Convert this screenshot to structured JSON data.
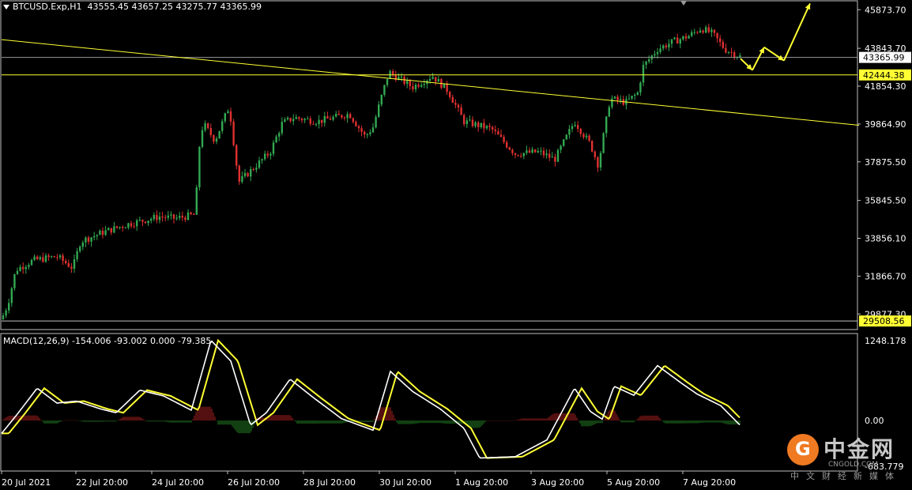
{
  "header": {
    "symbol": "BTCUSD.Exp,H1",
    "ohlc": "43555.45 43657.25 43275.77 43365.99"
  },
  "macd_header": "MACD(12,26,9) -154.006 -93.002 0.000 -79.385",
  "price_axis": [
    "45873.70",
    "43843.70",
    "41854.30",
    "39864.90",
    "37875.50",
    "35845.50",
    "33856.10",
    "31866.70",
    "29877.30"
  ],
  "macd_axis": [
    "1248.178",
    "0.00",
    "-683.779"
  ],
  "price_tags": {
    "current": "43365.99",
    "level_high": "42444.38",
    "level_low": "29508.56"
  },
  "time_axis": [
    "20 Jul 2021",
    "22 Jul 20:00",
    "24 Jul 20:00",
    "26 Jul 20:00",
    "28 Jul 20:00",
    "30 Jul 20:00",
    "1 Aug 20:00",
    "3 Aug 20:00",
    "5 Aug 20:00",
    "7 Aug 20:00"
  ],
  "watermark": {
    "cn": "中金网",
    "en": "CNGOLD.COM",
    "sub": "中文财经新媒体",
    "logo_glyph": "G"
  },
  "colors": {
    "bull": "#ffffff",
    "bull_body": "#32a852",
    "bear": "#e03030",
    "level": "#ffff33",
    "macd_line": "#ffffff",
    "signal_line": "#ffff33",
    "hist_pos": "#8b1a1a",
    "hist_neg": "#1f6b1f",
    "grid": "#c0c0c0"
  },
  "chart_data": {
    "type": "candlestick",
    "ylim": [
      29100,
      46300
    ],
    "macd_ylim": [
      -683.779,
      1248.178
    ],
    "anchors": [
      {
        "t": 0,
        "p": 29600
      },
      {
        "t": 8,
        "p": 30400
      },
      {
        "t": 18,
        "p": 32200
      },
      {
        "t": 40,
        "p": 32700
      },
      {
        "t": 70,
        "p": 32900
      },
      {
        "t": 90,
        "p": 32300
      },
      {
        "t": 100,
        "p": 33700
      },
      {
        "t": 130,
        "p": 34200
      },
      {
        "t": 160,
        "p": 34600
      },
      {
        "t": 180,
        "p": 34800
      },
      {
        "t": 200,
        "p": 35000
      },
      {
        "t": 220,
        "p": 34900
      },
      {
        "t": 245,
        "p": 35100
      },
      {
        "t": 250,
        "p": 38600
      },
      {
        "t": 255,
        "p": 39900
      },
      {
        "t": 270,
        "p": 39000
      },
      {
        "t": 288,
        "p": 40800
      },
      {
        "t": 300,
        "p": 36800
      },
      {
        "t": 320,
        "p": 37600
      },
      {
        "t": 340,
        "p": 38400
      },
      {
        "t": 355,
        "p": 39900
      },
      {
        "t": 370,
        "p": 40200
      },
      {
        "t": 400,
        "p": 40000
      },
      {
        "t": 440,
        "p": 40400
      },
      {
        "t": 460,
        "p": 39200
      },
      {
        "t": 470,
        "p": 39700
      },
      {
        "t": 480,
        "p": 41200
      },
      {
        "t": 490,
        "p": 42600
      },
      {
        "t": 520,
        "p": 41800
      },
      {
        "t": 545,
        "p": 42400
      },
      {
        "t": 565,
        "p": 41600
      },
      {
        "t": 585,
        "p": 40000
      },
      {
        "t": 620,
        "p": 39600
      },
      {
        "t": 650,
        "p": 38300
      },
      {
        "t": 680,
        "p": 38400
      },
      {
        "t": 700,
        "p": 38000
      },
      {
        "t": 725,
        "p": 40000
      },
      {
        "t": 745,
        "p": 38800
      },
      {
        "t": 755,
        "p": 37700
      },
      {
        "t": 770,
        "p": 41200
      },
      {
        "t": 790,
        "p": 41000
      },
      {
        "t": 805,
        "p": 41500
      },
      {
        "t": 812,
        "p": 42900
      },
      {
        "t": 830,
        "p": 43800
      },
      {
        "t": 850,
        "p": 44200
      },
      {
        "t": 870,
        "p": 44500
      },
      {
        "t": 885,
        "p": 44900
      },
      {
        "t": 900,
        "p": 44600
      },
      {
        "t": 915,
        "p": 43800
      },
      {
        "t": 935,
        "p": 43400
      }
    ],
    "levels": [
      43365.99,
      42444.38,
      29508.56
    ],
    "trendline": [
      [
        0,
        44300
      ],
      [
        1085,
        39800
      ]
    ],
    "projection": [
      [
        935,
        43300
      ],
      [
        950,
        42700
      ],
      [
        965,
        43900
      ],
      [
        990,
        43200
      ],
      [
        1023,
        46200
      ]
    ],
    "macd_anchors": [
      {
        "t": 0,
        "m": -200
      },
      {
        "t": 20,
        "m": 100
      },
      {
        "t": 45,
        "m": 500
      },
      {
        "t": 70,
        "m": 270
      },
      {
        "t": 95,
        "m": 300
      },
      {
        "t": 125,
        "m": 180
      },
      {
        "t": 145,
        "m": 120
      },
      {
        "t": 175,
        "m": 470
      },
      {
        "t": 205,
        "m": 380
      },
      {
        "t": 240,
        "m": 160
      },
      {
        "t": 265,
        "m": 1240
      },
      {
        "t": 290,
        "m": 920
      },
      {
        "t": 315,
        "m": -70
      },
      {
        "t": 335,
        "m": 120
      },
      {
        "t": 365,
        "m": 640
      },
      {
        "t": 395,
        "m": 350
      },
      {
        "t": 430,
        "m": 30
      },
      {
        "t": 470,
        "m": -150
      },
      {
        "t": 492,
        "m": 760
      },
      {
        "t": 520,
        "m": 450
      },
      {
        "t": 555,
        "m": 180
      },
      {
        "t": 585,
        "m": -120
      },
      {
        "t": 605,
        "m": -580
      },
      {
        "t": 650,
        "m": -560
      },
      {
        "t": 690,
        "m": -300
      },
      {
        "t": 725,
        "m": 500
      },
      {
        "t": 745,
        "m": 140
      },
      {
        "t": 760,
        "m": 20
      },
      {
        "t": 775,
        "m": 530
      },
      {
        "t": 800,
        "m": 390
      },
      {
        "t": 830,
        "m": 850
      },
      {
        "t": 860,
        "m": 580
      },
      {
        "t": 880,
        "m": 410
      },
      {
        "t": 910,
        "m": 230
      },
      {
        "t": 935,
        "m": -80
      }
    ]
  }
}
